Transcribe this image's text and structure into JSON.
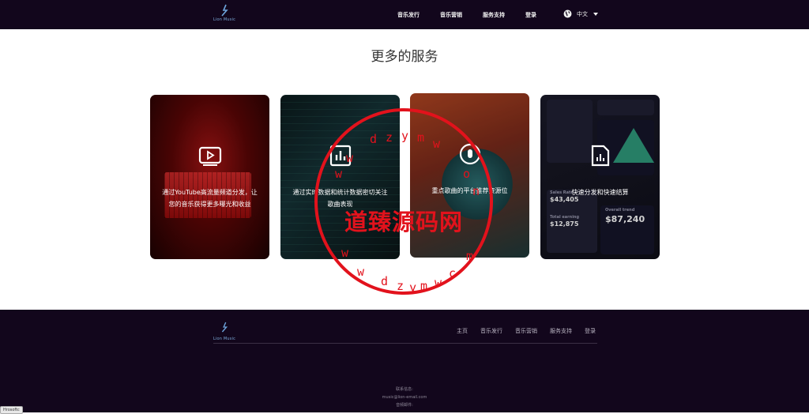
{
  "header": {
    "logo_text": "Lion Music",
    "nav": [
      "音乐发行",
      "音乐营销",
      "服务支持",
      "登录"
    ],
    "language": "中文"
  },
  "section_title": "更多的服务",
  "cards": [
    {
      "caption": "通过YouTube高流量频道分发，让您的音乐获得更多曝光和收益",
      "icon": "play-video-icon"
    },
    {
      "caption": "通过实时数据和统计数据密切关注歌曲表现",
      "icon": "bar-chart-icon"
    },
    {
      "caption": "重点歌曲的平台推荐资源位",
      "icon": "podcast-icon"
    },
    {
      "caption": "快速分发和快速结算",
      "icon": "document-chart-icon"
    }
  ],
  "dashboard": {
    "sales": "$43,405",
    "sales_label": "Sales Rate",
    "earning": "$12,875",
    "earning_label": "Total earning",
    "trend": "$87,240",
    "trend_label": "Overall trend"
  },
  "footer": {
    "logo_text": "Lion Music",
    "links": [
      "主页",
      "音乐发行",
      "音乐营销",
      "服务支持",
      "登录"
    ],
    "contact_label": "联系信息:",
    "email": "music@lion-email.com",
    "mail_label": "音频邮件:"
  },
  "watermark": {
    "main": "道臻源码网",
    "domain": "www.dzymw.com"
  },
  "corner_badge": "Hrosoftc"
}
